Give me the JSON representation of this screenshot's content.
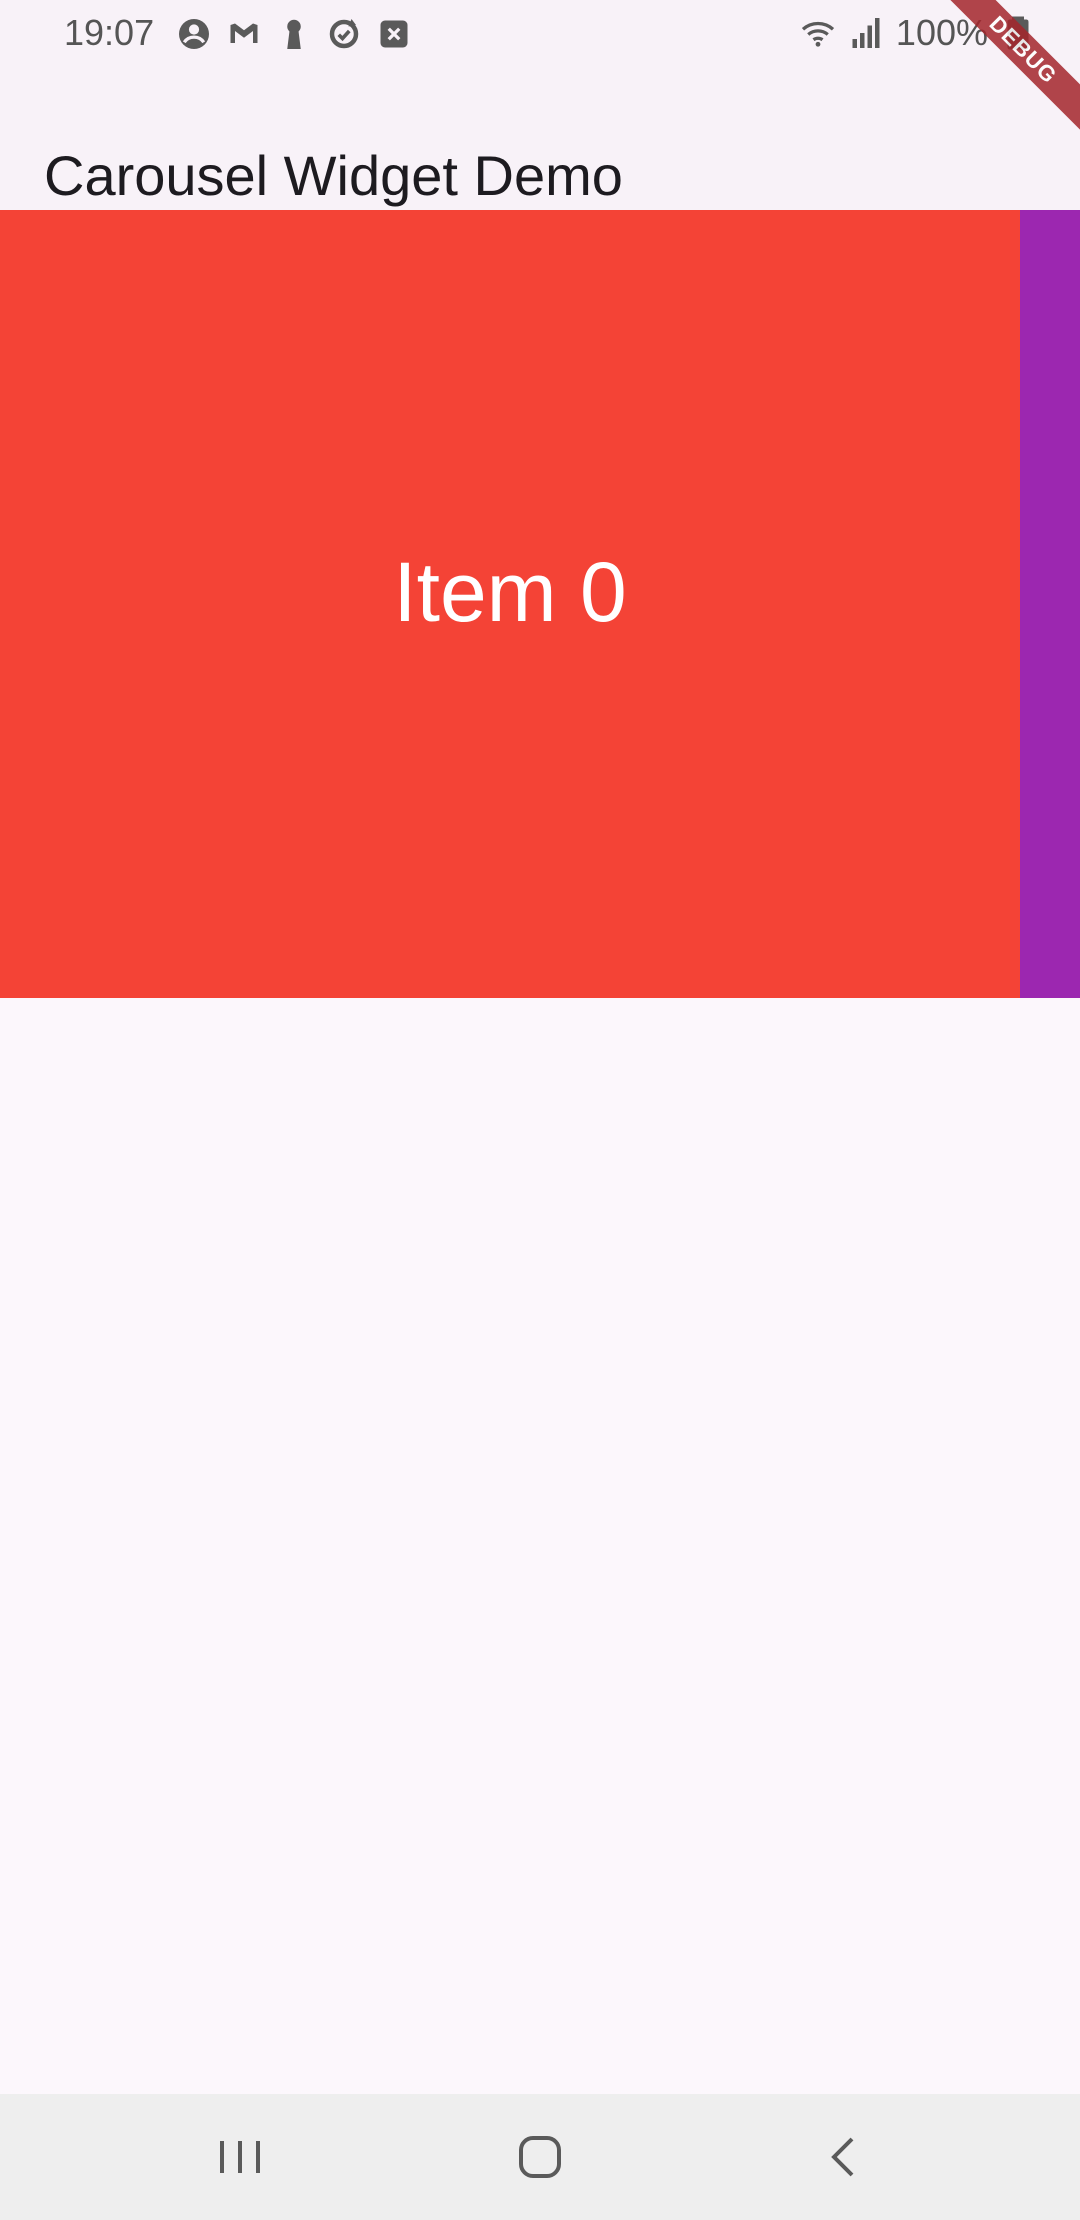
{
  "status_bar": {
    "time": "19:07",
    "battery": "100%",
    "left_icons": [
      "account-icon",
      "gmail-icon",
      "keyhole-icon",
      "sync-icon",
      "close-box-icon"
    ],
    "right_icons": [
      "wifi-icon",
      "signal-icon",
      "battery-icon"
    ]
  },
  "debug_banner": {
    "label": "DEBUG"
  },
  "app_bar": {
    "title": "Carousel Widget Demo"
  },
  "carousel": {
    "current_item": {
      "label": "Item 0",
      "color": "#f44336"
    },
    "next_item": {
      "color": "#9c27b0"
    }
  },
  "navigation_bar": {
    "buttons": [
      "recent-apps-icon",
      "home-icon",
      "back-icon"
    ]
  },
  "colors": {
    "background": "#fcf7fc",
    "app_bar": "#f8f2f8",
    "nav_bar": "#eeeeee",
    "title_text": "#1d1b20"
  }
}
